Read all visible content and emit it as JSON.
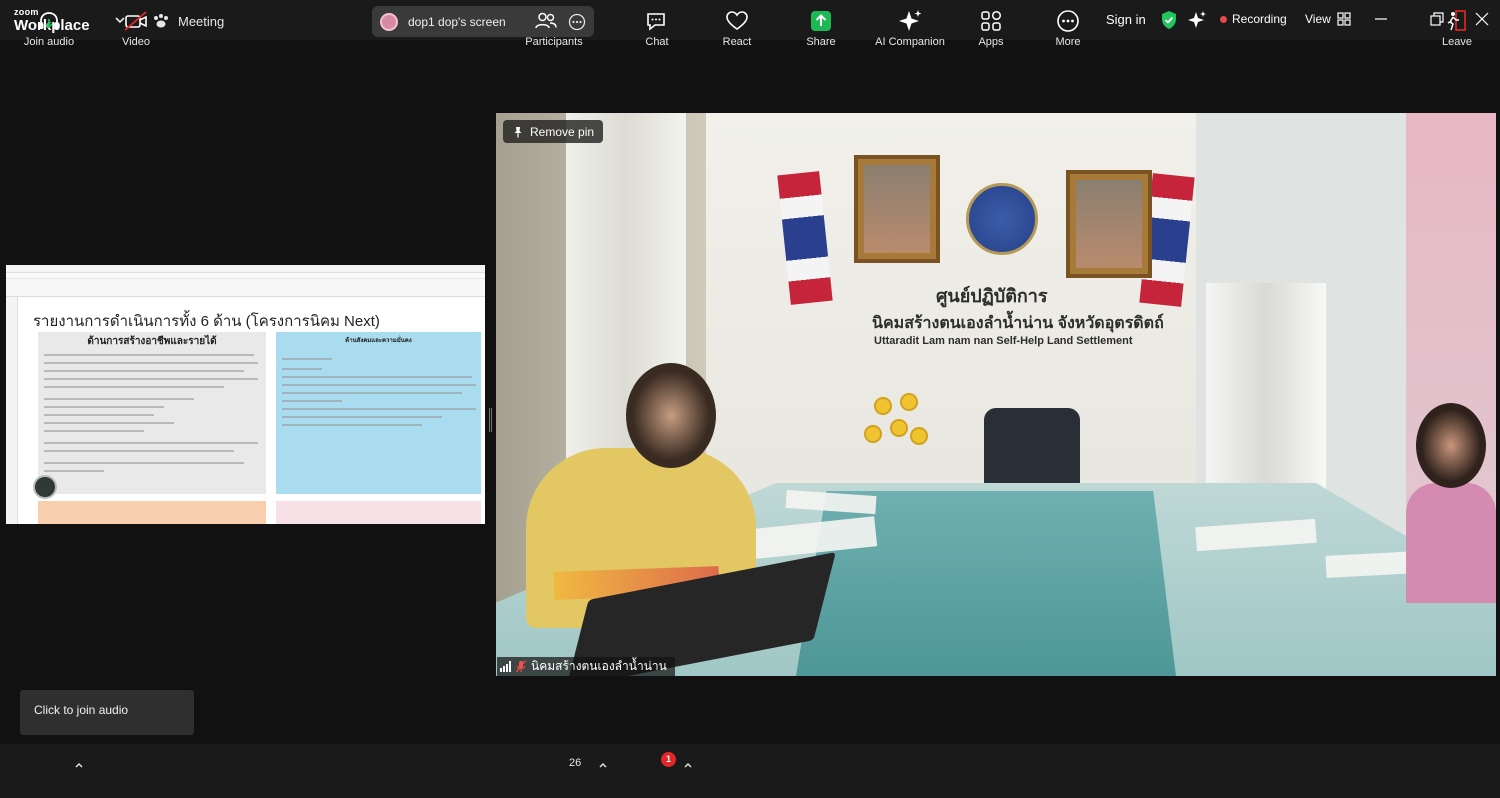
{
  "titlebar": {
    "brand_top": "zoom",
    "brand_bottom": "Workplace",
    "meeting_label": "Meeting",
    "screen_label": "dop1 dop's screen",
    "signin_label": "Sign in",
    "recording_label": "Recording",
    "view_label": "View"
  },
  "shared_screen": {
    "doc_heading": "รายงานการดำเนินการทั้ง 6 ด้าน (โครงการนิคม Next)",
    "box1_title": "ด้านการสร้างอาชีพและรายได้",
    "box2_title": "ด้านสังคมและความมั่นคง"
  },
  "video": {
    "sign_line1": "ศูนย์ปฏิบัติการ",
    "sign_line2": "นิคมสร้างตนเองลำน้ำน่าน จังหวัดอุตรดิตถ์",
    "sign_line3": "Uttaradit Lam nam nan Self-Help Land Settlement",
    "remove_pin_label": "Remove pin",
    "participant_name": "นิคมสร้างตนเองลำน้ำน่าน"
  },
  "tooltip": {
    "text": "Click to join audio"
  },
  "toolbar": {
    "join_audio": "Join audio",
    "video": "Video",
    "participants": "Participants",
    "participants_count": "26",
    "chat": "Chat",
    "chat_badge": "1",
    "react": "React",
    "share": "Share",
    "ai_companion": "AI Companion",
    "apps": "Apps",
    "more": "More",
    "leave": "Leave"
  },
  "colors": {
    "background": "#111111",
    "toolbar": "#1a1a1a",
    "share_green": "#1db954",
    "leave_red": "#e02828",
    "recording_red": "#e5484d",
    "shield_green": "#22c55e"
  }
}
